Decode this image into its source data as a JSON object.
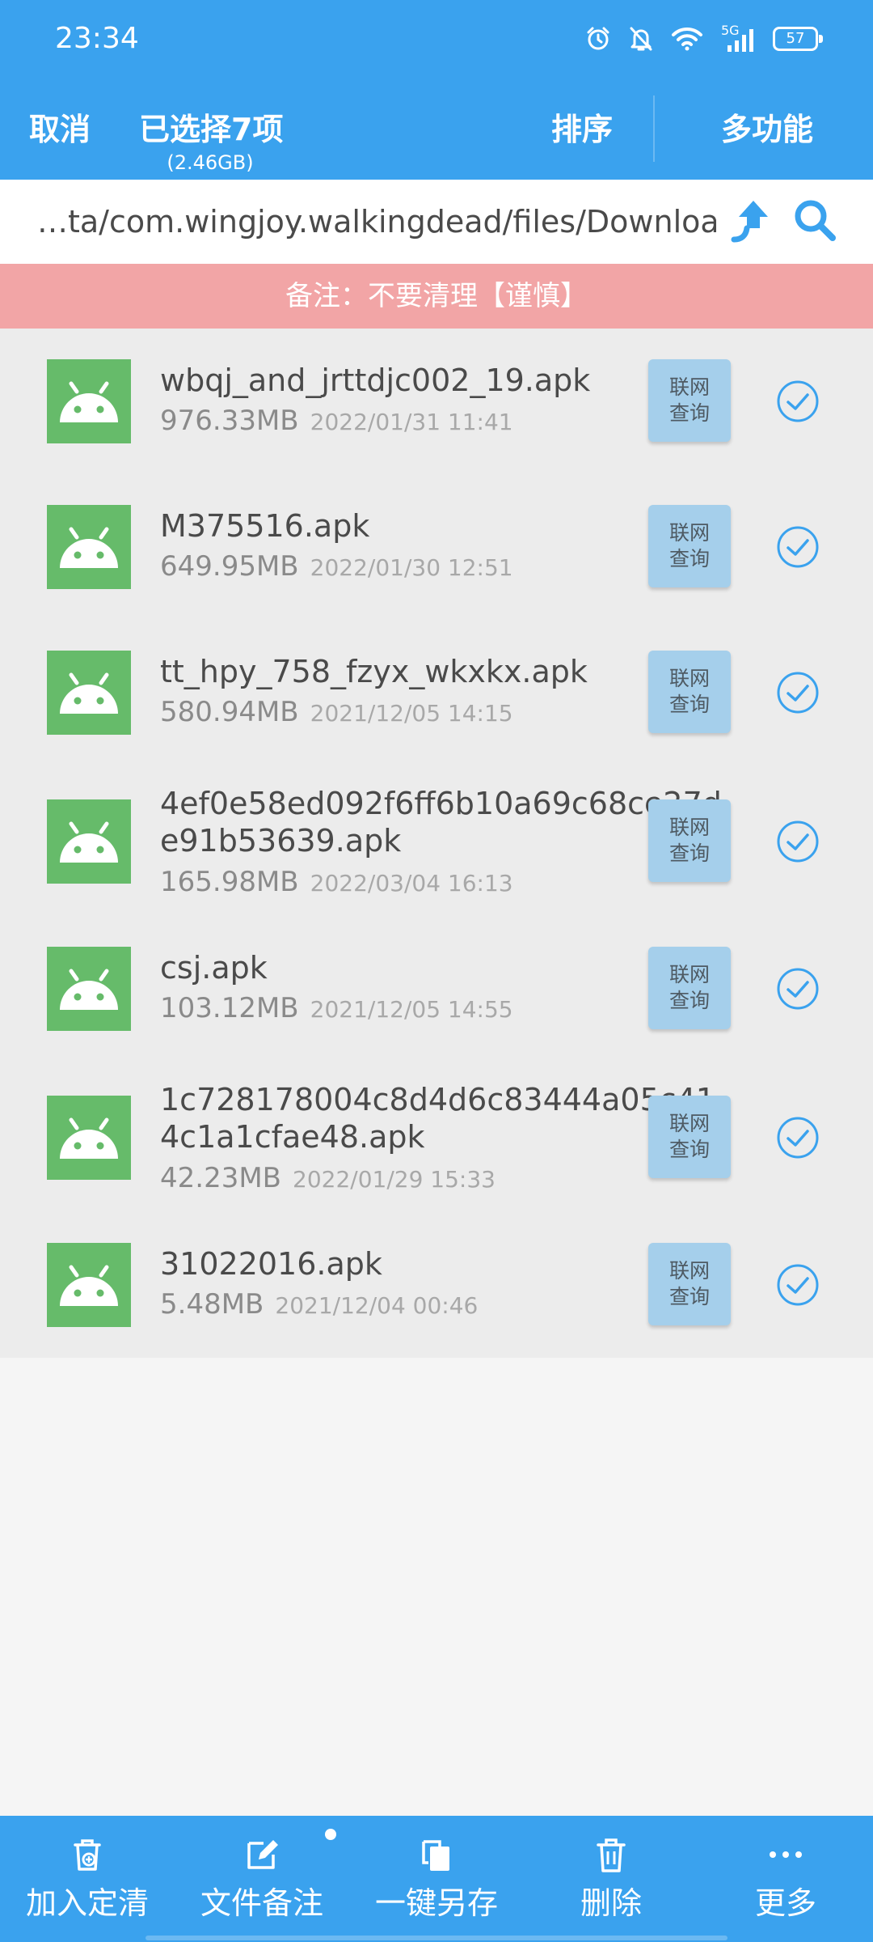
{
  "status_bar": {
    "time": "23:34",
    "network": "5G",
    "battery": "57",
    "icons": [
      "alarm-icon",
      "mute-bell-icon",
      "wifi-icon",
      "signal-icon",
      "battery-icon"
    ]
  },
  "action_bar": {
    "cancel_label": "取消",
    "selected_label": "已选择7项",
    "selected_size": "(2.46GB)",
    "sort_label": "排序",
    "multi_label": "多功能"
  },
  "path_bar": {
    "path": "…ta/com.wingjoy.walkingdead/files/Download",
    "icons": [
      "up-arrow-icon",
      "search-icon"
    ]
  },
  "note": {
    "text": "备注：不要清理【谨慎】"
  },
  "files": [
    {
      "name": "wbqj_and_jrttdjc002_19.apk",
      "size": "976.33MB",
      "date": "2022/01/31 11:41",
      "action": [
        "联网",
        "查询"
      ],
      "checked": true
    },
    {
      "name": "M375516.apk",
      "size": "649.95MB",
      "date": "2022/01/30 12:51",
      "action": [
        "联网",
        "查询"
      ],
      "checked": true
    },
    {
      "name": "tt_hpy_758_fzyx_wkxkx.apk",
      "size": "580.94MB",
      "date": "2021/12/05 14:15",
      "action": [
        "联网",
        "查询"
      ],
      "checked": true
    },
    {
      "name": "4ef0e58ed092f6ff6b10a69c68ce27de91b53639.apk",
      "size": "165.98MB",
      "date": "2022/03/04 16:13",
      "action": [
        "联网",
        "查询"
      ],
      "checked": true
    },
    {
      "name": "csj.apk",
      "size": "103.12MB",
      "date": "2021/12/05 14:55",
      "action": [
        "联网",
        "查询"
      ],
      "checked": true
    },
    {
      "name": "1c728178004c8d4d6c83444a05c414c1a1cfae48.apk",
      "size": "42.23MB",
      "date": "2022/01/29 15:33",
      "action": [
        "联网",
        "查询"
      ],
      "checked": true
    },
    {
      "name": "31022016.apk",
      "size": "5.48MB",
      "date": "2021/12/04 00:46",
      "action": [
        "联网",
        "查询"
      ],
      "checked": true
    }
  ],
  "toolbar": {
    "items": [
      {
        "label": "加入定清",
        "icon": "add-to-clean-icon"
      },
      {
        "label": "文件备注",
        "icon": "edit-note-icon"
      },
      {
        "label": "一键另存",
        "icon": "copy-icon"
      },
      {
        "label": "删除",
        "icon": "trash-icon"
      },
      {
        "label": "更多",
        "icon": "more-icon"
      }
    ]
  },
  "colors": {
    "primary": "#3aa2ee",
    "note_bg": "#f2a5a6",
    "apk_icon": "#66bb6a",
    "lookup_btn": "#a5cfeb",
    "check": "#3aa2ee"
  }
}
